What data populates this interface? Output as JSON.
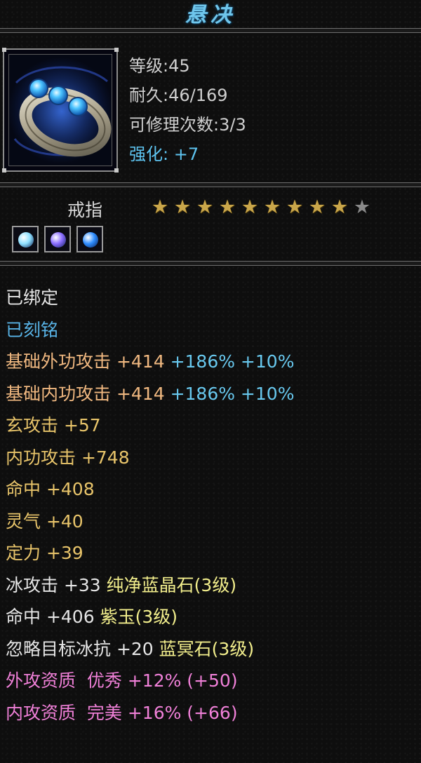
{
  "item": {
    "name": "悬决",
    "icon": "ring-icon",
    "level_text": "等级:45",
    "durability_text": "耐久:46/169",
    "repair_text": "可修理次数:3/3",
    "enhance_label": "强化:",
    "enhance_value": "+7",
    "type_label": "戒指",
    "stars_total": 10,
    "stars_filled": 9,
    "sockets": [
      {
        "name": "gem-socket-1",
        "color": "#8fe0ff"
      },
      {
        "name": "gem-socket-2",
        "color": "#8a6cff"
      },
      {
        "name": "gem-socket-3",
        "color": "#2e8cff"
      }
    ]
  },
  "attributes": [
    {
      "parts": [
        {
          "t": "已绑定",
          "c": "w"
        }
      ]
    },
    {
      "parts": [
        {
          "t": "已刻铭",
          "c": "b"
        }
      ]
    },
    {
      "parts": [
        {
          "t": "基础外功攻击 +414 ",
          "c": "o"
        },
        {
          "t": "+186% +10%",
          "c": "c"
        }
      ]
    },
    {
      "parts": [
        {
          "t": "基础内功攻击 +414 ",
          "c": "o"
        },
        {
          "t": "+186% +10%",
          "c": "c"
        }
      ]
    },
    {
      "parts": [
        {
          "t": "玄攻击 +57",
          "c": "y"
        }
      ]
    },
    {
      "parts": [
        {
          "t": "内功攻击 +748",
          "c": "y"
        }
      ]
    },
    {
      "parts": [
        {
          "t": "命中 +408",
          "c": "y"
        }
      ]
    },
    {
      "parts": [
        {
          "t": "灵气 +40",
          "c": "y"
        }
      ]
    },
    {
      "parts": [
        {
          "t": "定力 +39",
          "c": "y"
        }
      ]
    },
    {
      "parts": [
        {
          "t": "冰攻击 +33 ",
          "c": "w"
        },
        {
          "t": "纯净蓝晶石(3级)",
          "c": "yg"
        }
      ]
    },
    {
      "parts": [
        {
          "t": "命中 +406 ",
          "c": "w"
        },
        {
          "t": "紫玉(3级)",
          "c": "yg"
        }
      ]
    },
    {
      "parts": [
        {
          "t": "忽略目标冰抗 +20 ",
          "c": "w"
        },
        {
          "t": "蓝冥石(3级)",
          "c": "yg"
        }
      ]
    },
    {
      "parts": [
        {
          "t": "外攻资质  优秀 +12% (+50)",
          "c": "p"
        }
      ]
    },
    {
      "parts": [
        {
          "t": "内攻资质  完美 +16% (+66)",
          "c": "p"
        }
      ]
    }
  ]
}
